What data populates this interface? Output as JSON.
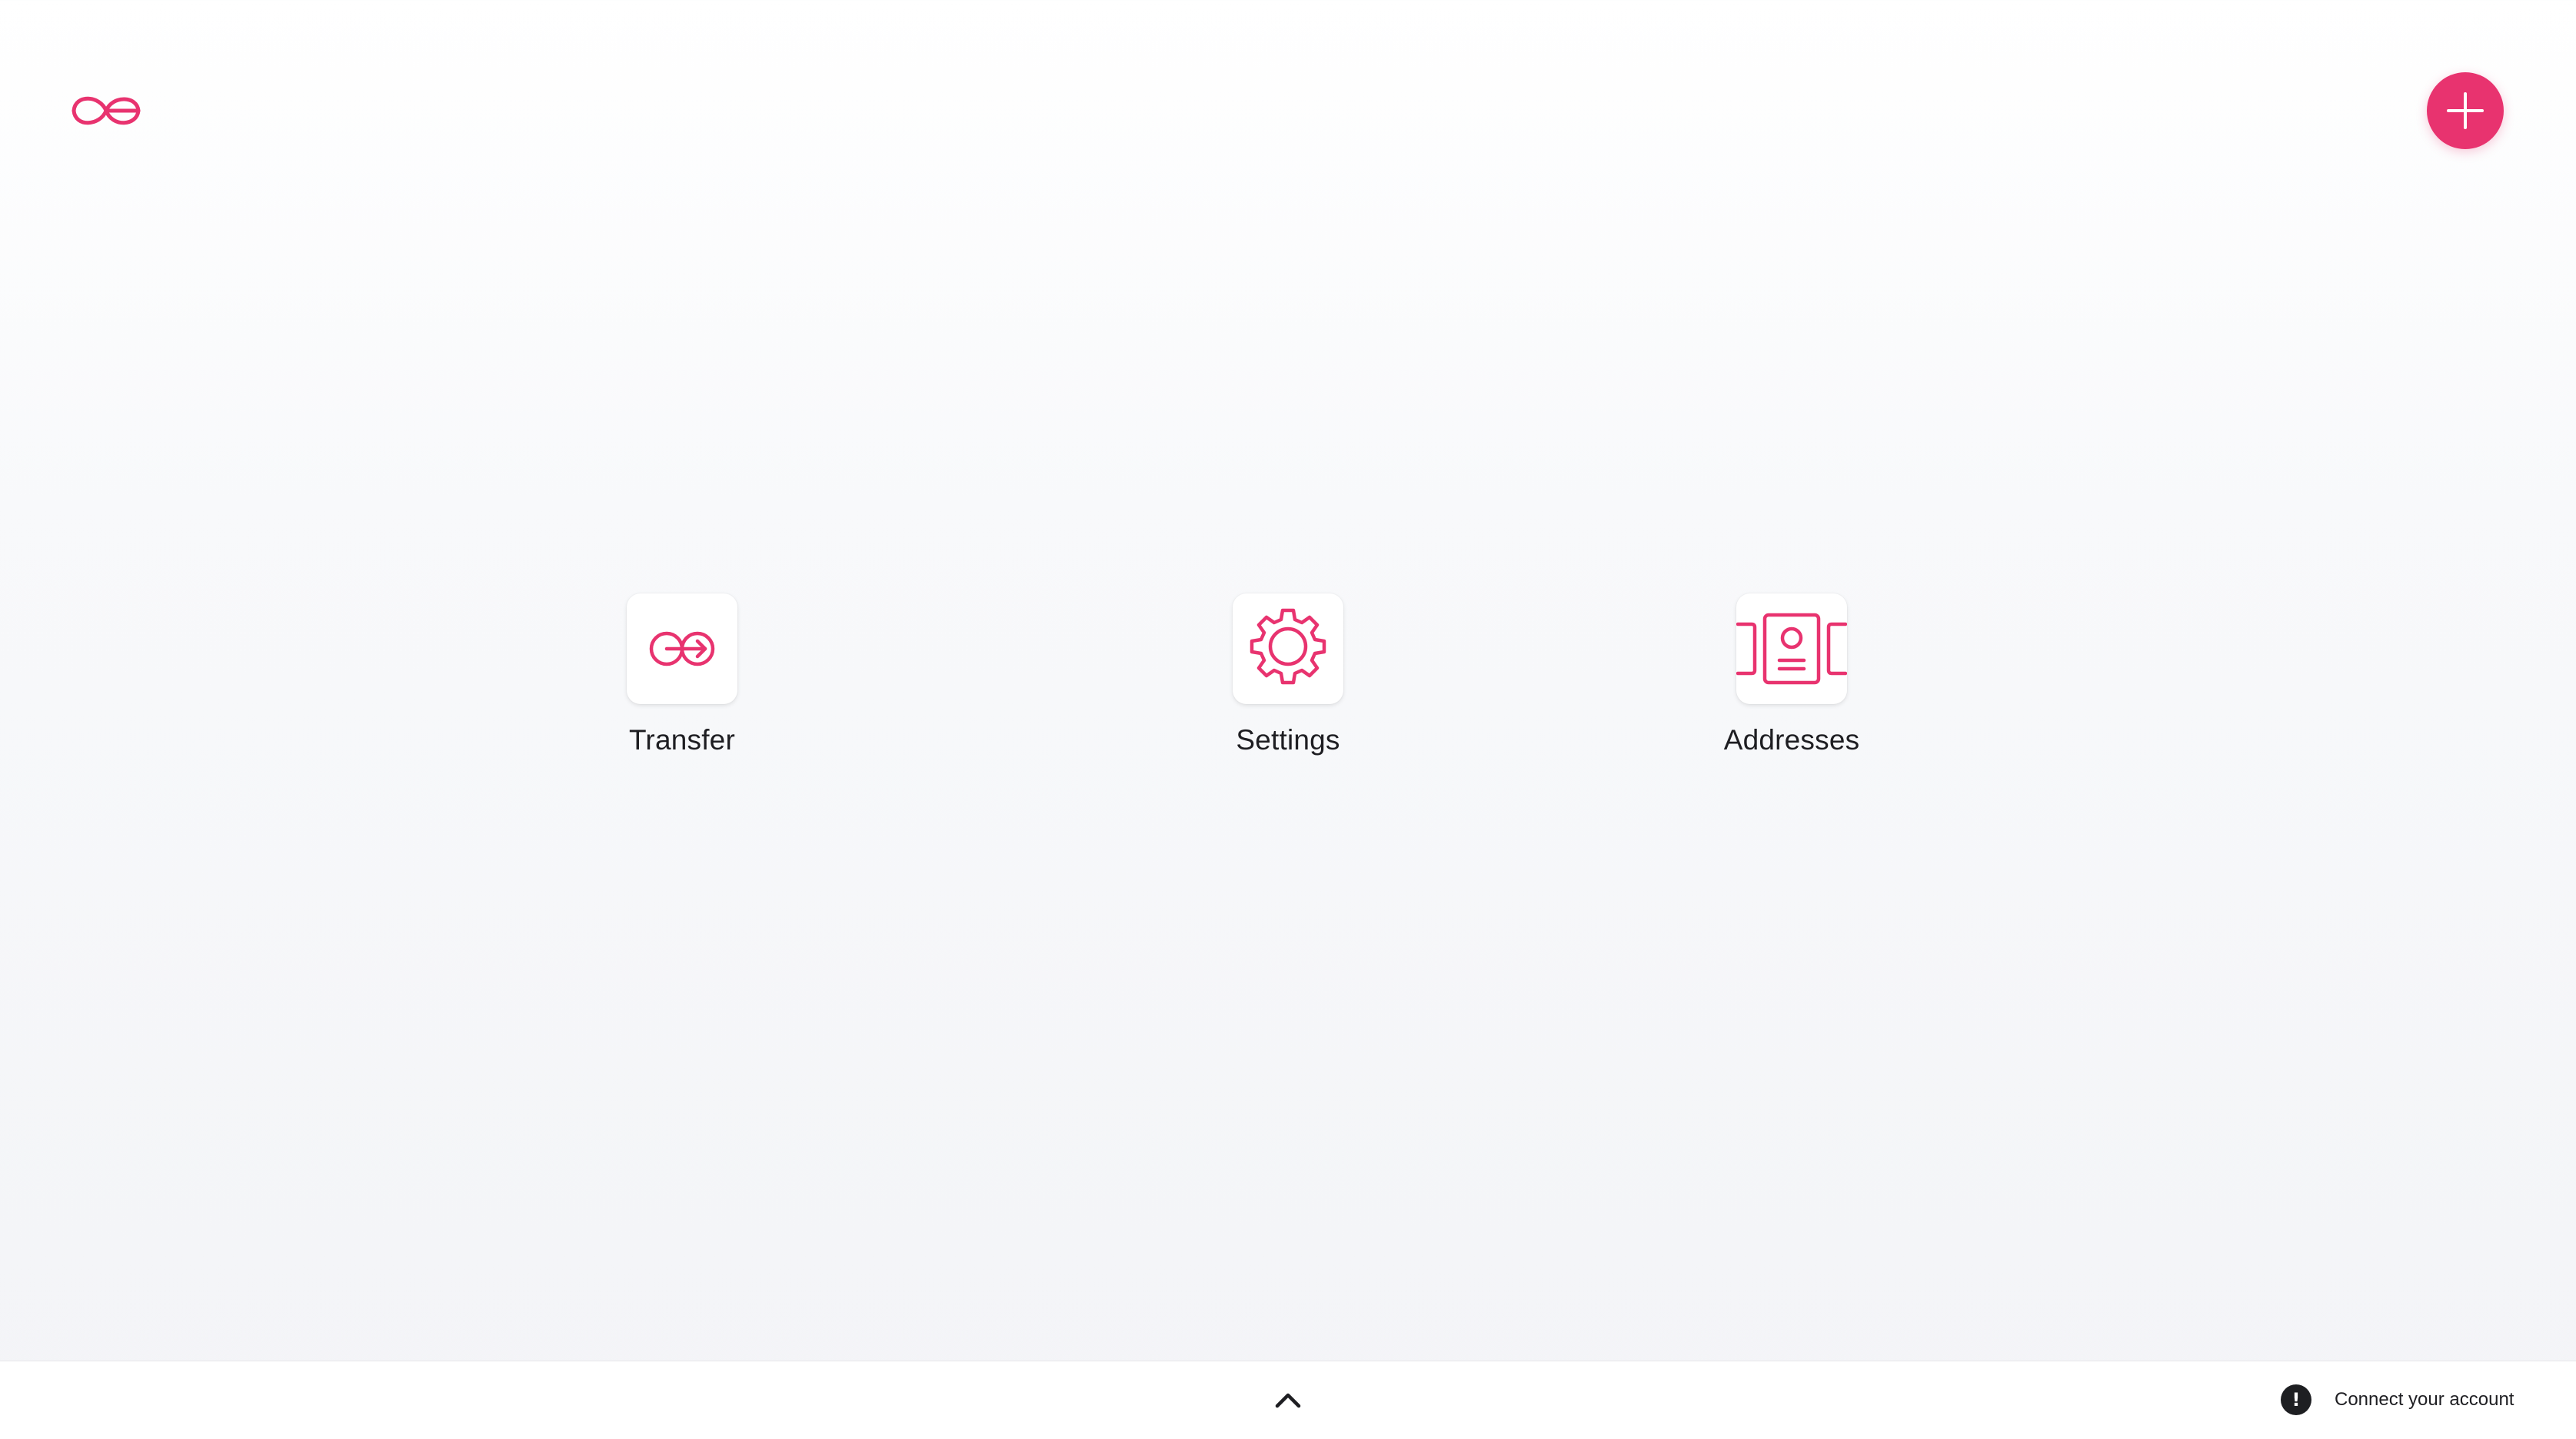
{
  "header": {
    "logo_icon": "infinity-e-logo-icon",
    "add_icon": "plus-icon"
  },
  "apps": [
    {
      "label": "Transfer",
      "icon": "transfer-icon"
    },
    {
      "label": "Settings",
      "icon": "gear-icon"
    },
    {
      "label": "Addresses",
      "icon": "address-book-icon"
    }
  ],
  "bottom_bar": {
    "expand_icon": "chevron-up-icon",
    "status_icon": "alert-icon",
    "status_glyph": "!",
    "status_text": "Connect your account"
  },
  "colors": {
    "accent": "#e8336f",
    "text": "#1e1e22",
    "status_badge": "#1e1f22"
  }
}
